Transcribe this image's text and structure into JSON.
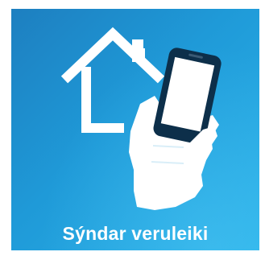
{
  "tile": {
    "label": "Sýndar veruleiki",
    "icon": "house-with-phone-in-hand-icon",
    "background_color": "#1f9ad8",
    "icon_color": "#ffffff",
    "phone_color": "#0d2f4a"
  }
}
